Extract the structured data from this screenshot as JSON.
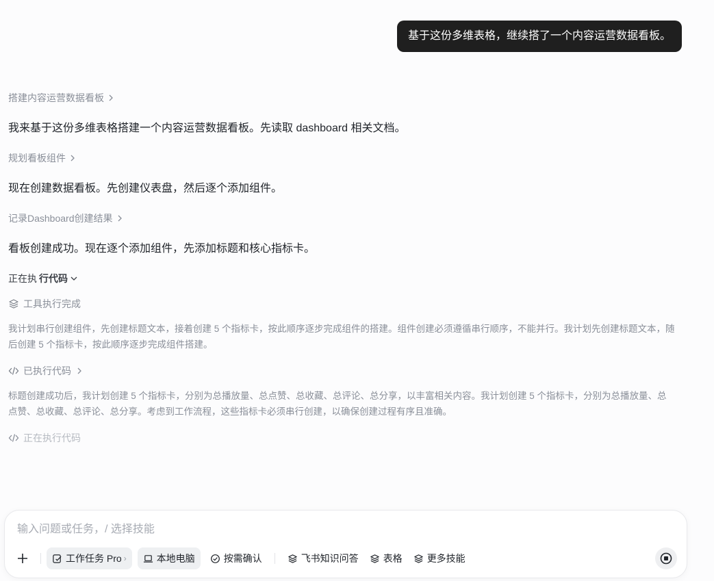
{
  "user_message": "基于这份多维表格，继续搭了一个内容运营数据看板。",
  "steps": [
    {
      "link": "搭建内容运营数据看板",
      "message": "我来基于这份多维表格搭建一个内容运营数据看板。先读取 dashboard 相关文档。"
    },
    {
      "link": "规划看板组件",
      "message": "现在创建数据看板。先创建仪表盘，然后逐个添加组件。"
    },
    {
      "link": "记录Dashboard创建结果",
      "message": "看板创建成功。现在逐个添加组件，先添加标题和核心指标卡。"
    }
  ],
  "running": {
    "prefix": "正在执",
    "bold": "行代码",
    "tool_done": "工具执行完成",
    "thought_1": "我计划串行创建组件，先创建标题文本，接着创建 5 个指标卡，按此顺序逐步完成组件的搭建。组件创建必须遵循串行顺序，不能并行。我计划先创建标题文本，随后创建 5 个指标卡，按此顺序逐步完成组件搭建。",
    "executed_code": "已执行代码",
    "thought_2": "标题创建成功后，我计划创建 5 个指标卡，分别为总播放量、总点赞、总收藏、总评论、总分享，以丰富相关内容。我计划创建 5 个指标卡，分别为总播放量、总点赞、总收藏、总评论、总分享。考虑到工作流程，这些指标卡必须串行创建，以确保创建过程有序且准确。",
    "executing_code": "正在执行代码"
  },
  "composer": {
    "placeholder": "输入问题或任务，/ 选择技能",
    "chips": {
      "work_task": "工作任务 Pro",
      "local_pc": "本地电脑",
      "confirm": "按需确认",
      "feishu_qa": "飞书知识问答",
      "table": "表格",
      "more_skills": "更多技能"
    }
  }
}
